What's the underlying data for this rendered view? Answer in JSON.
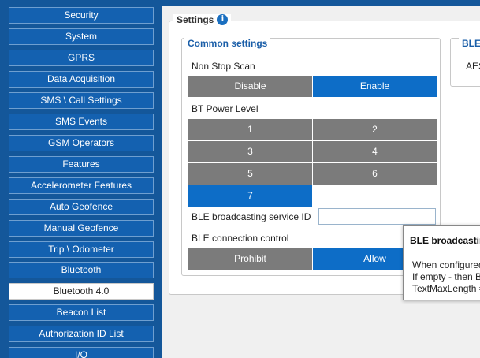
{
  "sidebar": {
    "items": [
      {
        "label": "Security"
      },
      {
        "label": "System"
      },
      {
        "label": "GPRS"
      },
      {
        "label": "Data Acquisition"
      },
      {
        "label": "SMS \\ Call Settings"
      },
      {
        "label": "SMS Events"
      },
      {
        "label": "GSM Operators"
      },
      {
        "label": "Features"
      },
      {
        "label": "Accelerometer Features"
      },
      {
        "label": "Auto Geofence"
      },
      {
        "label": "Manual Geofence"
      },
      {
        "label": "Trip \\ Odometer"
      },
      {
        "label": "Bluetooth"
      },
      {
        "label": "Bluetooth 4.0"
      },
      {
        "label": "Beacon List"
      },
      {
        "label": "Authorization ID List"
      },
      {
        "label": "I/O"
      }
    ],
    "active": "Bluetooth 4.0"
  },
  "settings": {
    "title": "Settings",
    "info_icon": "i",
    "common": {
      "title": "Common settings",
      "non_stop_scan": {
        "label": "Non Stop Scan",
        "options": [
          "Disable",
          "Enable"
        ],
        "selected": "Enable"
      },
      "bt_power_level": {
        "label": "BT Power Level",
        "options": [
          "1",
          "2",
          "3",
          "4",
          "5",
          "6",
          "7"
        ],
        "selected": "7"
      },
      "ble_service_id": {
        "label": "BLE broadcasting service ID",
        "value": ""
      },
      "ble_connection_control": {
        "label": "BLE connection control",
        "options": [
          "Prohibit",
          "Allow"
        ],
        "selected": "Allow"
      }
    },
    "ble_group": {
      "title": "BLE",
      "text": "AES"
    }
  },
  "tooltip": {
    "title": "BLE broadcastin",
    "lines": [
      "When configured",
      "If empty - then B",
      "TextMaxLength ="
    ]
  },
  "colors": {
    "sidebar_bg": "#14579a",
    "nav_button": "#1461b0",
    "selected_blue": "#0d6dc7",
    "unselected_grey": "#7b7b7b",
    "group_title": "#1a5ea8"
  }
}
